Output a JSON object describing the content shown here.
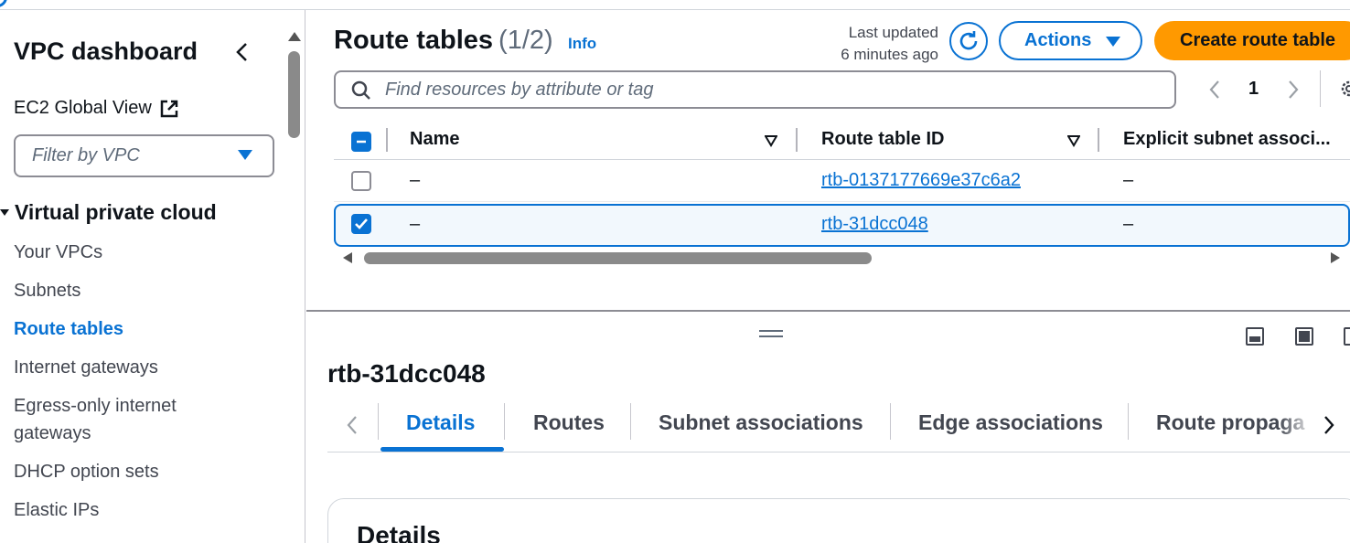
{
  "sidebar": {
    "title": "VPC dashboard",
    "ec2_global_view": "EC2 Global View",
    "filter_placeholder": "Filter by VPC",
    "section": "Virtual private cloud",
    "items": [
      {
        "label": "Your VPCs",
        "active": false
      },
      {
        "label": "Subnets",
        "active": false
      },
      {
        "label": "Route tables",
        "active": true
      },
      {
        "label": "Internet gateways",
        "active": false
      },
      {
        "label": "Egress-only internet",
        "active": false
      },
      {
        "label": "gateways",
        "active": false
      },
      {
        "label": "DHCP option sets",
        "active": false
      },
      {
        "label": "Elastic IPs",
        "active": false
      }
    ]
  },
  "header": {
    "title": "Route tables",
    "count": "(1/2)",
    "info": "Info",
    "updated_line1": "Last updated",
    "updated_line2": "6 minutes ago",
    "actions_label": "Actions",
    "create_label": "Create route table"
  },
  "search": {
    "placeholder": "Find resources by attribute or tag"
  },
  "pagination": {
    "current_page": "1"
  },
  "table": {
    "columns": [
      "Name",
      "Route table ID",
      "Explicit subnet associ..."
    ],
    "rows": [
      {
        "selected": false,
        "name": "–",
        "route_table_id": "rtb-0137177669e37c6a2",
        "explicit_subnet": "–"
      },
      {
        "selected": true,
        "name": "–",
        "route_table_id": "rtb-31dcc048",
        "explicit_subnet": "–"
      }
    ]
  },
  "detail": {
    "title": "rtb-31dcc048",
    "tabs": [
      "Details",
      "Routes",
      "Subnet associations",
      "Edge associations",
      "Route propaga"
    ],
    "active_tab": "Details",
    "card_title": "Details"
  },
  "colors": {
    "accent": "#0972d3",
    "primary_button": "#ff9900",
    "selected_row_bg": "#f2f8fd"
  }
}
